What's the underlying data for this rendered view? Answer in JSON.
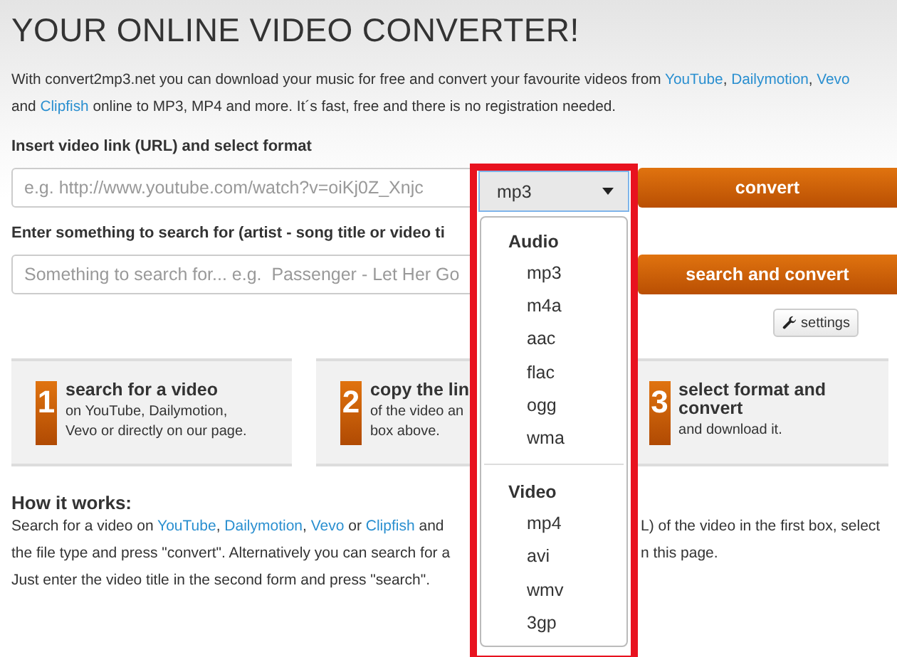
{
  "title": "YOUR ONLINE VIDEO CONVERTER!",
  "intro": [
    [
      {
        "text": "With convert2mp3.net you can download your music for free and convert your favourite videos from "
      },
      {
        "text": "YouTube",
        "link": true
      },
      {
        "text": ", "
      },
      {
        "text": "Dailymotion",
        "link": true
      },
      {
        "text": ", "
      },
      {
        "text": "Vevo",
        "link": true
      }
    ],
    [
      {
        "text": "and "
      },
      {
        "text": "Clipfish",
        "link": true
      },
      {
        "text": " online to MP3, MP4 and more. It´s fast, free and there is no registration needed."
      }
    ]
  ],
  "url_form": {
    "label": "Insert video link (URL) and select format",
    "placeholder": "e.g. http://www.youtube.com/watch?v=oiKj0Z_Xnjc",
    "format": "mp3",
    "button": "convert"
  },
  "search_form": {
    "label": "Enter something to search for (artist - song title or video ti",
    "placeholder": "Something to search for... e.g.  Passenger - Let Her Go",
    "button": "search and convert"
  },
  "settings_button": "settings",
  "steps": [
    {
      "number": "1",
      "title": "search for a video",
      "lines": [
        "on YouTube, Dailymotion,",
        "Vevo or directly on our page."
      ]
    },
    {
      "number": "2",
      "title": "copy the lin",
      "lines": [
        "of the video an",
        "box above."
      ]
    },
    {
      "number": "3",
      "title": "select format and convert",
      "lines": [
        "and download it."
      ]
    }
  ],
  "how": {
    "heading": "How it works:",
    "lines": [
      {
        "left": [
          {
            "text": "Search for a video on "
          },
          {
            "text": "YouTube",
            "link": true
          },
          {
            "text": ", "
          },
          {
            "text": "Dailymotion",
            "link": true
          },
          {
            "text": ", "
          },
          {
            "text": "Vevo",
            "link": true
          },
          {
            "text": " or "
          },
          {
            "text": "Clipfish",
            "link": true
          },
          {
            "text": " and"
          }
        ],
        "right": "L) of the video in the first box, select"
      },
      {
        "left": [
          {
            "text": "the file type and press \"convert\". Alternatively you can search for a"
          }
        ],
        "right": "n this page."
      },
      {
        "left": [
          {
            "text": "Just enter the video title in the second form and press \"search\"."
          }
        ]
      }
    ]
  },
  "dropdown": {
    "groups": [
      {
        "label": "Audio",
        "options": [
          "mp3",
          "m4a",
          "aac",
          "flac",
          "ogg",
          "wma"
        ]
      },
      {
        "label": "Video",
        "options": [
          "mp4",
          "avi",
          "wmv",
          "3gp"
        ]
      }
    ]
  }
}
